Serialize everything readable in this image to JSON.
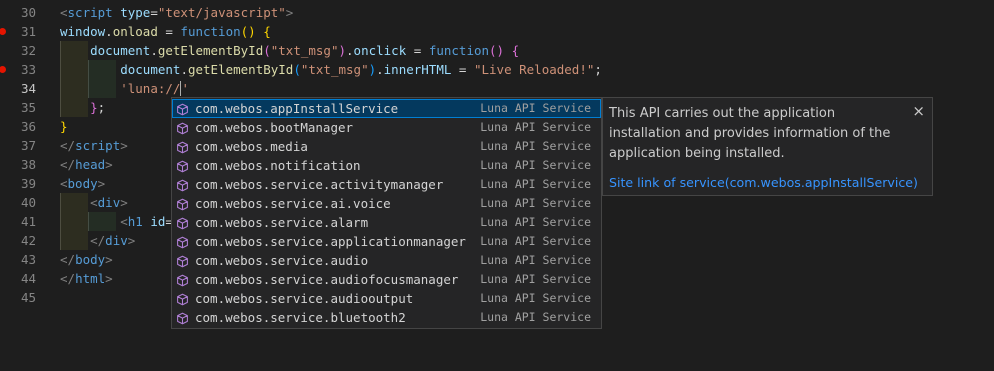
{
  "editor": {
    "line_numbers": [
      "30",
      "31",
      "32",
      "33",
      "34",
      "35",
      "36",
      "37",
      "38",
      "39",
      "40",
      "41",
      "42",
      "43",
      "44",
      "45"
    ],
    "breakpoint_lines": [
      "31",
      "33"
    ],
    "active_line": "34",
    "lines": [
      [
        {
          "c": "t-tag",
          "t": "<"
        },
        {
          "c": "t-name",
          "t": "script"
        },
        {
          "c": "t-plain",
          "t": " "
        },
        {
          "c": "t-attr",
          "t": "type"
        },
        {
          "c": "t-plain",
          "t": "="
        },
        {
          "c": "t-str",
          "t": "\"text/javascript\""
        },
        {
          "c": "t-tag",
          "t": ">"
        }
      ],
      [
        {
          "c": "t-attr",
          "t": "window"
        },
        {
          "c": "t-plain",
          "t": "."
        },
        {
          "c": "t-fn",
          "t": "onload"
        },
        {
          "c": "t-plain",
          "t": " = "
        },
        {
          "c": "t-kw",
          "t": "function"
        },
        {
          "c": "t-br1",
          "t": "()"
        },
        {
          "c": "t-plain",
          "t": " "
        },
        {
          "c": "t-br1",
          "t": "{"
        }
      ],
      [
        {
          "c": "t-plain",
          "t": "    "
        },
        {
          "c": "t-attr",
          "t": "document"
        },
        {
          "c": "t-plain",
          "t": "."
        },
        {
          "c": "t-fn",
          "t": "getElementById"
        },
        {
          "c": "t-br2",
          "t": "("
        },
        {
          "c": "t-str",
          "t": "\"txt_msg\""
        },
        {
          "c": "t-br2",
          "t": ")"
        },
        {
          "c": "t-plain",
          "t": "."
        },
        {
          "c": "t-attr",
          "t": "onclick"
        },
        {
          "c": "t-plain",
          "t": " = "
        },
        {
          "c": "t-kw",
          "t": "function"
        },
        {
          "c": "t-br2",
          "t": "()"
        },
        {
          "c": "t-plain",
          "t": " "
        },
        {
          "c": "t-br2",
          "t": "{"
        }
      ],
      [
        {
          "c": "t-plain",
          "t": "        "
        },
        {
          "c": "t-attr",
          "t": "document"
        },
        {
          "c": "t-plain",
          "t": "."
        },
        {
          "c": "t-fn",
          "t": "getElementById"
        },
        {
          "c": "t-br3",
          "t": "("
        },
        {
          "c": "t-str",
          "t": "\"txt_msg\""
        },
        {
          "c": "t-br3",
          "t": ")"
        },
        {
          "c": "t-plain",
          "t": "."
        },
        {
          "c": "t-attr",
          "t": "innerHTML"
        },
        {
          "c": "t-plain",
          "t": " = "
        },
        {
          "c": "t-str",
          "t": "\"Live Reloaded!\""
        },
        {
          "c": "t-plain",
          "t": ";"
        }
      ],
      [
        {
          "c": "t-plain",
          "t": "        "
        },
        {
          "c": "t-str",
          "t": "'luna://"
        },
        {
          "c": "cursor",
          "t": ""
        },
        {
          "c": "t-str",
          "t": "'"
        }
      ],
      [
        {
          "c": "t-plain",
          "t": "    "
        },
        {
          "c": "t-br2",
          "t": "}"
        },
        {
          "c": "t-plain",
          "t": ";"
        }
      ],
      [
        {
          "c": "t-br1",
          "t": "}"
        }
      ],
      [
        {
          "c": "t-tag",
          "t": "</"
        },
        {
          "c": "t-name",
          "t": "script"
        },
        {
          "c": "t-tag",
          "t": ">"
        }
      ],
      [
        {
          "c": "t-tag",
          "t": "</"
        },
        {
          "c": "t-name",
          "t": "head"
        },
        {
          "c": "t-tag",
          "t": ">"
        }
      ],
      [
        {
          "c": "t-tag",
          "t": "<"
        },
        {
          "c": "t-name",
          "t": "body"
        },
        {
          "c": "t-tag",
          "t": ">"
        }
      ],
      [
        {
          "c": "t-plain",
          "t": "    "
        },
        {
          "c": "t-tag",
          "t": "<"
        },
        {
          "c": "t-name",
          "t": "div"
        },
        {
          "c": "t-tag",
          "t": ">"
        }
      ],
      [
        {
          "c": "t-plain",
          "t": "        "
        },
        {
          "c": "t-tag",
          "t": "<"
        },
        {
          "c": "t-name",
          "t": "h1"
        },
        {
          "c": "t-plain",
          "t": " "
        },
        {
          "c": "t-attr",
          "t": "id"
        },
        {
          "c": "t-plain",
          "t": "="
        },
        {
          "c": "t-str",
          "t": "\""
        }
      ],
      [
        {
          "c": "t-plain",
          "t": "    "
        },
        {
          "c": "t-tag",
          "t": "</"
        },
        {
          "c": "t-name",
          "t": "div"
        },
        {
          "c": "t-tag",
          "t": ">"
        }
      ],
      [
        {
          "c": "t-tag",
          "t": "</"
        },
        {
          "c": "t-name",
          "t": "body"
        },
        {
          "c": "t-tag",
          "t": ">"
        }
      ],
      [
        {
          "c": "t-tag",
          "t": "</"
        },
        {
          "c": "t-name",
          "t": "html"
        },
        {
          "c": "t-tag",
          "t": ">"
        }
      ],
      []
    ]
  },
  "suggest": {
    "selected_index": 0,
    "items": [
      {
        "label": "com.webos.appInstallService",
        "detail": "Luna API Service"
      },
      {
        "label": "com.webos.bootManager",
        "detail": "Luna API Service"
      },
      {
        "label": "com.webos.media",
        "detail": "Luna API Service"
      },
      {
        "label": "com.webos.notification",
        "detail": "Luna API Service"
      },
      {
        "label": "com.webos.service.activitymanager",
        "detail": "Luna API Service"
      },
      {
        "label": "com.webos.service.ai.voice",
        "detail": "Luna API Service"
      },
      {
        "label": "com.webos.service.alarm",
        "detail": "Luna API Service"
      },
      {
        "label": "com.webos.service.applicationmanager",
        "detail": "Luna API Service"
      },
      {
        "label": "com.webos.service.audio",
        "detail": "Luna API Service"
      },
      {
        "label": "com.webos.service.audiofocusmanager",
        "detail": "Luna API Service"
      },
      {
        "label": "com.webos.service.audiooutput",
        "detail": "Luna API Service"
      },
      {
        "label": "com.webos.service.bluetooth2",
        "detail": "Luna API Service"
      }
    ],
    "icon": "cube-icon",
    "icon_color": "#b180d7"
  },
  "details": {
    "description": "This API carries out the application installation and provides information of the application being installed.",
    "link_text": "Site link of service(com.webos.appInstallService)",
    "close_glyph": "×"
  },
  "colors": {
    "background": "#1e1e1e",
    "selection": "#04395e",
    "focus_border": "#007fd4",
    "link": "#3794ff",
    "breakpoint": "#e51400"
  }
}
